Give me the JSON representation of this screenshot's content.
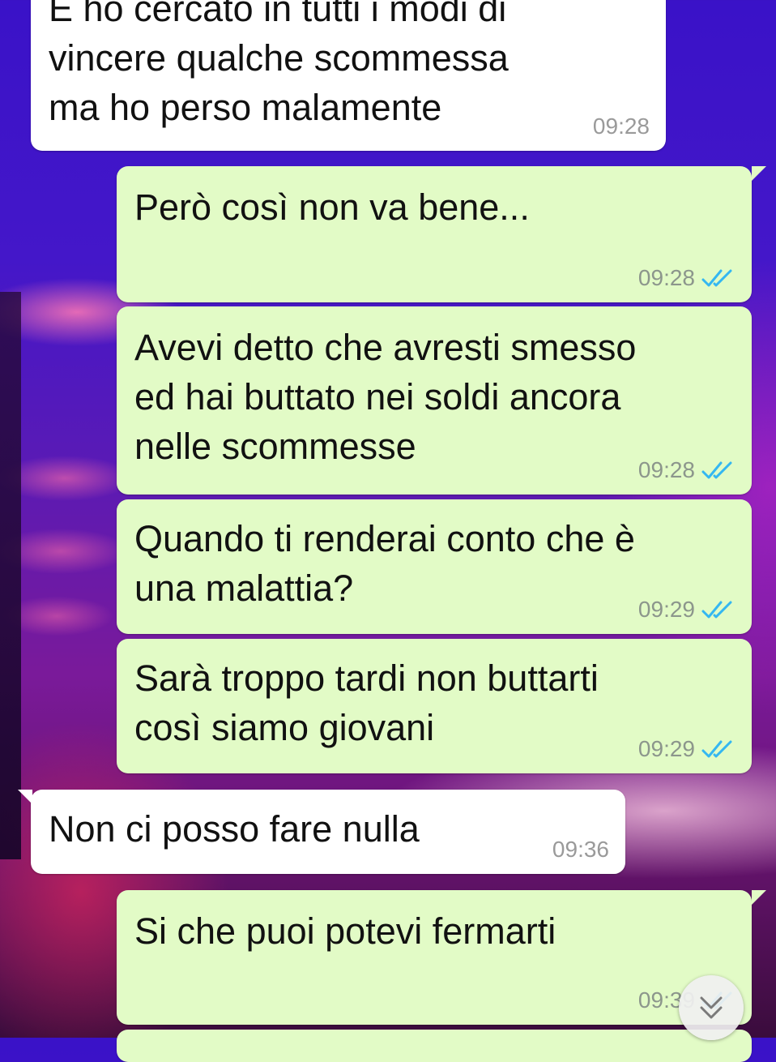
{
  "messages": [
    {
      "direction": "in",
      "text": "E ho cercato in tutti i modi di\nvincere qualche scommessa\nma ho perso malamente",
      "time": "09:28"
    },
    {
      "direction": "out",
      "text": "Però così non va bene...",
      "time": "09:28",
      "status": "read"
    },
    {
      "direction": "out",
      "text": "Avevi detto che avresti smesso\ned hai buttato nei soldi ancora\nnelle scommesse",
      "time": "09:28",
      "status": "read"
    },
    {
      "direction": "out",
      "text": "Quando ti renderai conto che è\nuna malattia?",
      "time": "09:29",
      "status": "read"
    },
    {
      "direction": "out",
      "text": "Sarà troppo tardi non buttarti\ncosì siamo giovani",
      "time": "09:29",
      "status": "read"
    },
    {
      "direction": "in",
      "text": "Non ci posso fare nulla",
      "time": "09:36"
    },
    {
      "direction": "out",
      "text": "Si che puoi potevi fermarti",
      "time": "09:39",
      "status": "read"
    }
  ],
  "scroll_button": {
    "icon": "double-chevron-down-icon"
  },
  "colors": {
    "incoming": "#ffffff",
    "outgoing": "#e2fbc6",
    "read_ticks": "#34b7f1"
  }
}
